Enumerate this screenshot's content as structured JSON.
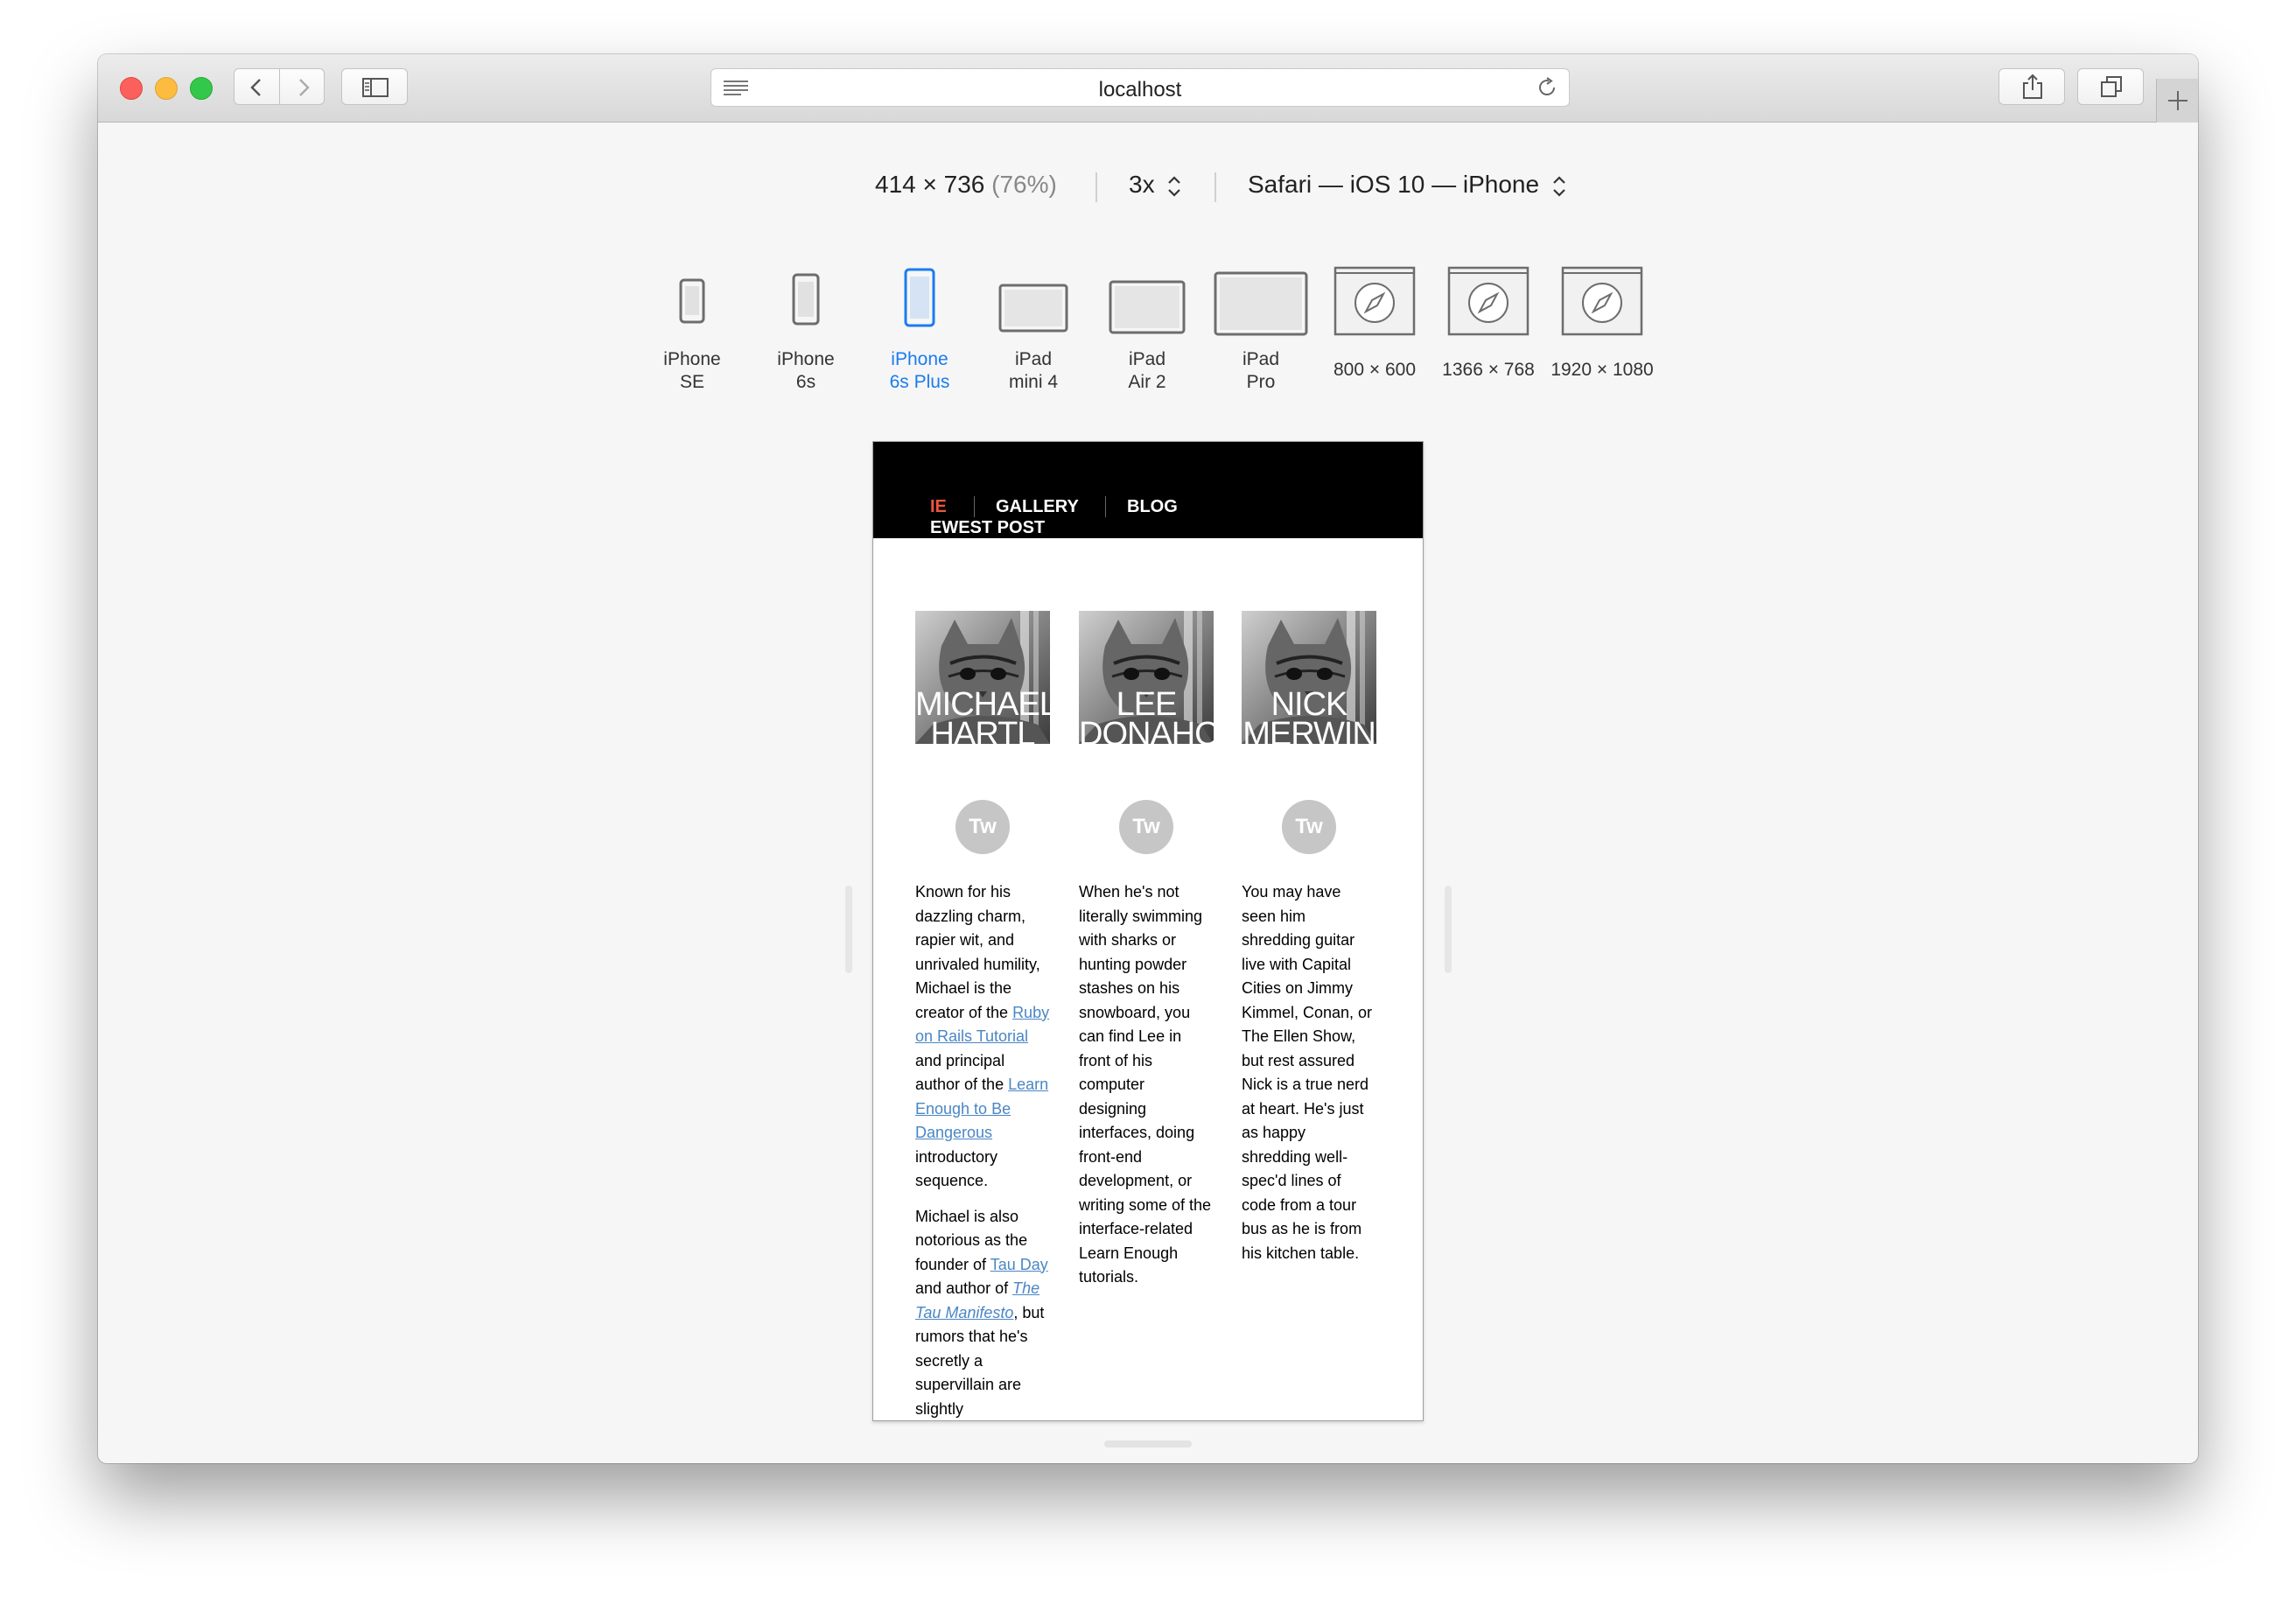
{
  "browser": {
    "url": "localhost"
  },
  "rdm": {
    "size": "414 × 736",
    "zoom": "(76%)",
    "scale": "3x",
    "user_agent": "Safari — iOS 10 — iPhone",
    "devices": [
      {
        "label": "iPhone\nSE",
        "icon": "phone-icon"
      },
      {
        "label": "iPhone\n6s",
        "icon": "phone-icon"
      },
      {
        "label": "iPhone\n6s Plus",
        "icon": "phone-icon",
        "active": true
      },
      {
        "label": "iPad\nmini 4",
        "icon": "tablet-icon"
      },
      {
        "label": "iPad\nAir 2",
        "icon": "tablet-icon"
      },
      {
        "label": "iPad\nPro",
        "icon": "tablet-icon"
      },
      {
        "label": "800 × 600",
        "icon": "safari-compass-icon"
      },
      {
        "label": "1366 × 768",
        "icon": "safari-compass-icon"
      },
      {
        "label": "1920 × 1080",
        "icon": "safari-compass-icon"
      }
    ]
  },
  "site": {
    "nav": {
      "home": "IE",
      "gallery": "GALLERY",
      "blog": "BLOG",
      "newest": "EWEST POST"
    },
    "people": [
      {
        "name_line1": "MICHAEL",
        "name_line2": "HARTL",
        "twitter": "Tw",
        "bio": [
          [
            {
              "t": "Known for his dazzling charm, rapier wit, and unrivaled humility, Michael is the creator of the "
            },
            {
              "t": "Ruby on Rails Tutorial",
              "link": true
            },
            {
              "t": " and principal author of the "
            },
            {
              "t": "Learn Enough to Be Dangerous",
              "link": true
            },
            {
              "t": " introductory sequence."
            }
          ],
          [
            {
              "t": "Michael is also notorious as the founder of "
            },
            {
              "t": "Tau Day",
              "link": true
            },
            {
              "t": " and author of "
            },
            {
              "t": "The Tau Manifesto",
              "link": true,
              "italic": true
            },
            {
              "t": ", but rumors that he's secretly a supervillain are slightly exaggerated."
            }
          ]
        ]
      },
      {
        "name_line1": "LEE",
        "name_line2": "DONAHOE",
        "twitter": "Tw",
        "bio": [
          [
            {
              "t": "When he's not literally swimming with sharks or hunting powder stashes on his snowboard, you can find Lee in front of his computer designing interfaces, doing front-end development, or writing some of the interface-related Learn Enough tutorials."
            }
          ]
        ]
      },
      {
        "name_line1": "NICK",
        "name_line2": "MERWIN",
        "twitter": "Tw",
        "bio": [
          [
            {
              "t": "You may have seen him shredding guitar live with Capital Cities on Jimmy Kimmel, Conan, or The Ellen Show, but rest assured Nick is a true nerd at heart. He's just as happy shredding well-spec'd lines of code from a tour bus as he is from his kitchen table."
            }
          ]
        ]
      }
    ]
  }
}
